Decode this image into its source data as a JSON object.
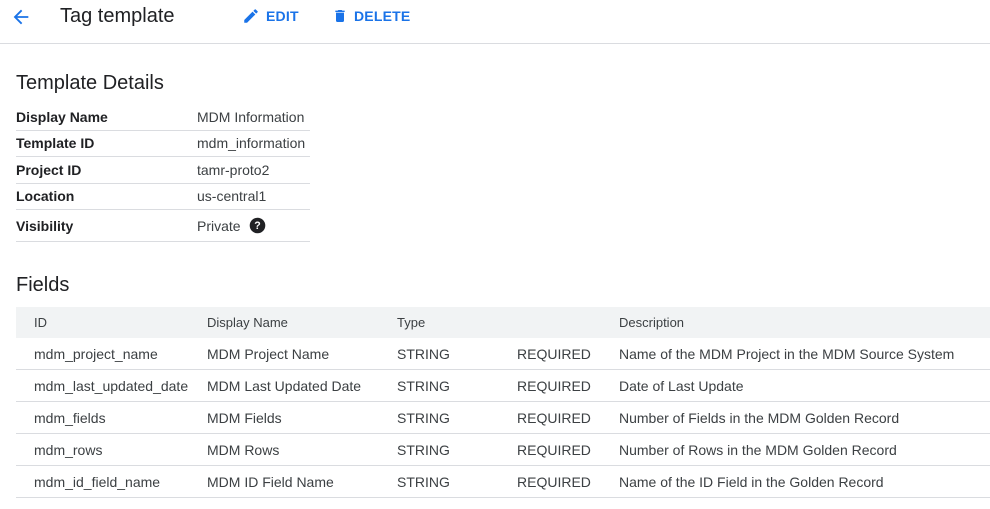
{
  "header": {
    "title": "Tag template",
    "edit_label": "EDIT",
    "delete_label": "DELETE",
    "accent": "#1a73e8"
  },
  "details": {
    "title": "Template Details",
    "rows": [
      {
        "label": "Display Name",
        "value": "MDM Information"
      },
      {
        "label": "Template ID",
        "value": "mdm_information"
      },
      {
        "label": "Project ID",
        "value": "tamr-proto2"
      },
      {
        "label": "Location",
        "value": "us-central1"
      },
      {
        "label": "Visibility",
        "value": "Private",
        "icon": "help-icon"
      }
    ]
  },
  "fields": {
    "title": "Fields",
    "columns": [
      "ID",
      "Display Name",
      "Type",
      "",
      "Description"
    ],
    "rows": [
      {
        "id": "mdm_project_name",
        "display_name": "MDM Project Name",
        "type": "STRING",
        "required": "REQUIRED",
        "description": "Name of the MDM Project in the MDM Source System"
      },
      {
        "id": "mdm_last_updated_date",
        "display_name": "MDM Last Updated Date",
        "type": "STRING",
        "required": "REQUIRED",
        "description": "Date of Last Update"
      },
      {
        "id": "mdm_fields",
        "display_name": "MDM Fields",
        "type": "STRING",
        "required": "REQUIRED",
        "description": "Number of Fields in the MDM Golden Record"
      },
      {
        "id": "mdm_rows",
        "display_name": "MDM Rows",
        "type": "STRING",
        "required": "REQUIRED",
        "description": "Number of Rows in the MDM Golden Record"
      },
      {
        "id": "mdm_id_field_name",
        "display_name": "MDM ID Field Name",
        "type": "STRING",
        "required": "REQUIRED",
        "description": "Name of the ID Field in the Golden Record"
      }
    ]
  }
}
